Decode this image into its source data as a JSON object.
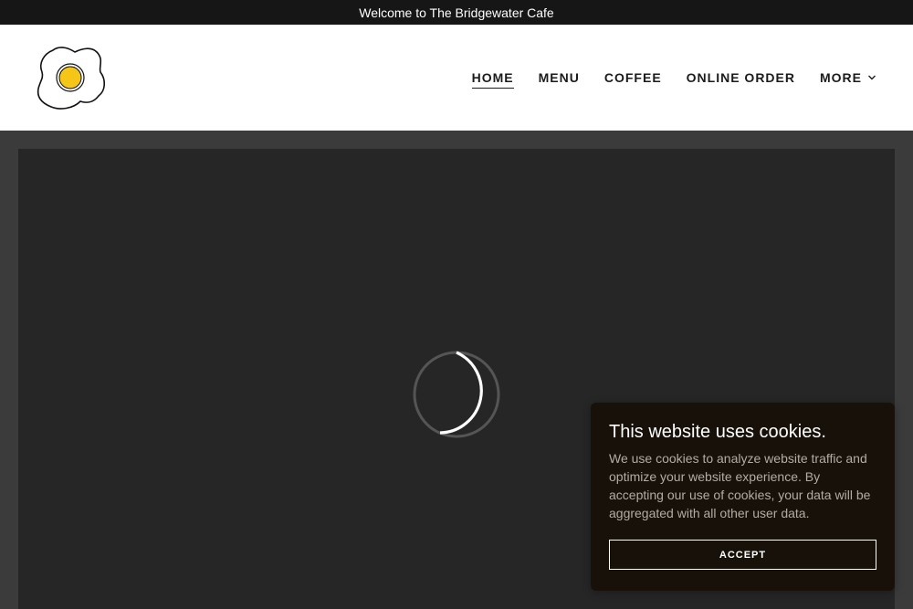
{
  "announcement": {
    "text": "Welcome to The Bridgewater Cafe"
  },
  "header": {
    "logo_icon": "fried-egg-icon",
    "nav": [
      {
        "label": "HOME",
        "active": true
      },
      {
        "label": "MENU",
        "active": false
      },
      {
        "label": "COFFEE",
        "active": false
      },
      {
        "label": "ONLINE ORDER",
        "active": false
      },
      {
        "label": "MORE",
        "active": false,
        "icon": "chevron-down-icon"
      }
    ]
  },
  "hero": {
    "icon": "loading-spinner-icon"
  },
  "cookie_banner": {
    "title": "This website uses cookies.",
    "body": "We use cookies to analyze website traffic and optimize your website experience. By accepting our use of cookies, your data will be aggregated with all other user data.",
    "accept_label": "ACCEPT"
  },
  "colors": {
    "announcement_bg": "#161616",
    "hero_bg": "#262626",
    "page_bg": "#3b3b3b",
    "cookie_bg": "#171109",
    "egg_yolk": "#f5c518"
  }
}
